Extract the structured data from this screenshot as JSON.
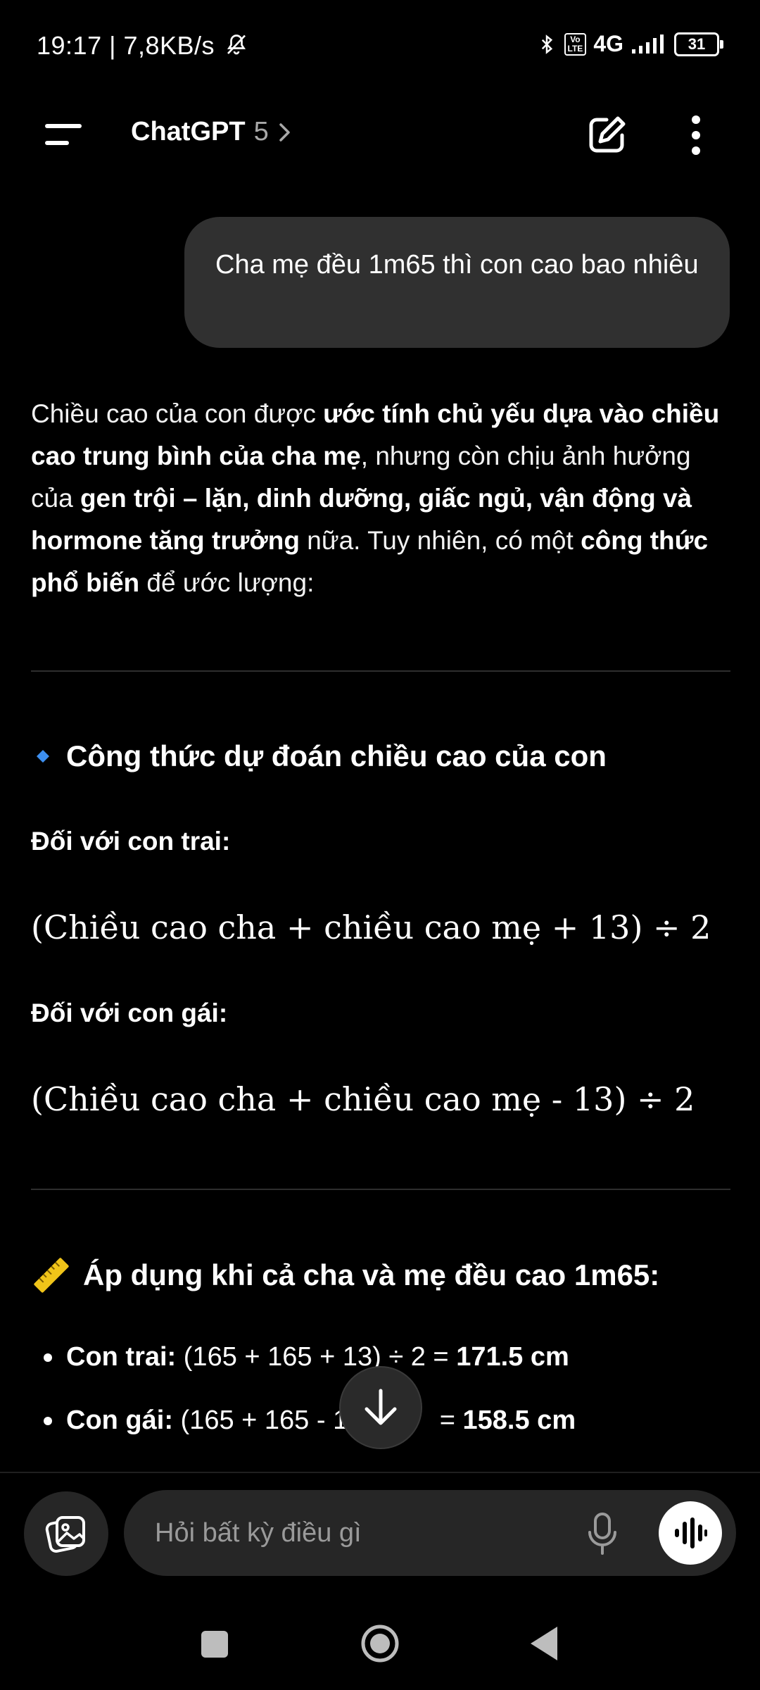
{
  "status_bar": {
    "time_speed": "19:17 | 7,8KB/s",
    "volte": "Vo\nLTE",
    "network": "4G",
    "battery": "31"
  },
  "header": {
    "title": "ChatGPT",
    "model": "5"
  },
  "conversation": {
    "user_message": "Cha mẹ đều 1m65 thì con cao bao nhiêu",
    "intro": {
      "p1": "Chiều cao của con được ",
      "b1": "ước tính chủ yếu dựa vào chiều cao trung bình của cha mẹ",
      "p2": ", nhưng còn chịu ảnh hưởng của ",
      "b2": "gen trội – lặn, dinh dưỡng, giấc ngủ, vận động và hormone tăng trưởng",
      "p3": " nữa. Tuy nhiên, có một ",
      "b3": "công thức phổ biến",
      "p4": " để ước lượng:"
    },
    "section1": {
      "heading": "Công thức dự đoán chiều cao của con",
      "boy_label": "Đối với con trai:",
      "boy_formula": "(Chiều cao cha + chiều cao mẹ + 13)  ÷ 2",
      "girl_label": "Đối với con gái:",
      "girl_formula": "(Chiều cao cha + chiều cao mẹ - 13)  ÷ 2"
    },
    "section2": {
      "heading": "Áp dụng khi cả cha và mẹ đều cao 1m65:",
      "boy_label": "Con trai:",
      "boy_calc": " (165 + 165 + 13) ÷ 2 = ",
      "boy_result": "171.5 cm",
      "girl_label": "Con gái:",
      "girl_calc": " (165 + 165 - 1",
      "girl_calc_end": " = ",
      "girl_result": "158.5 cm"
    }
  },
  "composer": {
    "placeholder": "Hỏi bất kỳ điều gì"
  }
}
